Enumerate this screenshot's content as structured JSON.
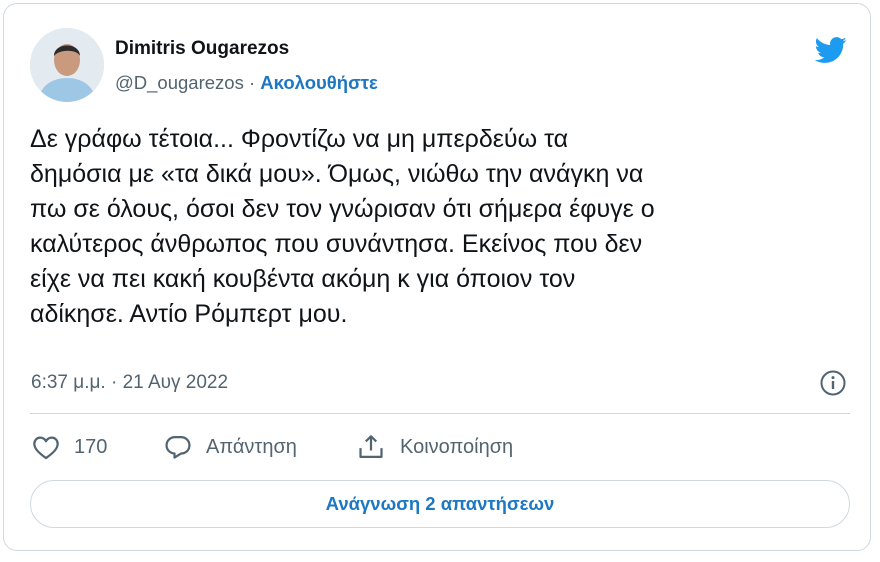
{
  "tweet": {
    "author_name": "Dimitris Ougarezos",
    "handle": "@D_ougarezos",
    "separator": " · ",
    "follow_label": "Ακολουθήστε",
    "text": "Δε γράφω τέτοια... Φροντίζω να μη μπερδεύω τα\nδημόσια με «τα δικά μου». Όμως, νιώθω την ανάγκη να\nπω σε όλους, όσοι δεν τον γνώρισαν ότι σήμερα έφυγε ο\nκαλύτερος άνθρωπος που συνάντησα. Εκείνος που δεν\nείχε να πει κακή κουβέντα ακόμη κ για όποιον τον\nαδίκησε. Αντίο Ρόμπερτ μου.",
    "timestamp": "6:37 μ.μ. · 21 Αυγ 2022"
  },
  "actions": {
    "like_count": "170",
    "reply_label": "Απάντηση",
    "share_label": "Κοινοποίηση"
  },
  "read_replies_label": "Ανάγνωση 2 απαντήσεων",
  "icons": {
    "brand": "twitter-bird-icon",
    "info": "info-icon",
    "like": "heart-icon",
    "reply": "speech-bubble-icon",
    "share": "share-upload-icon"
  },
  "colors": {
    "twitter_blue": "#1d9bf0",
    "link_blue": "#1d77c2",
    "secondary_text": "#536471",
    "border": "#cfd9de"
  }
}
